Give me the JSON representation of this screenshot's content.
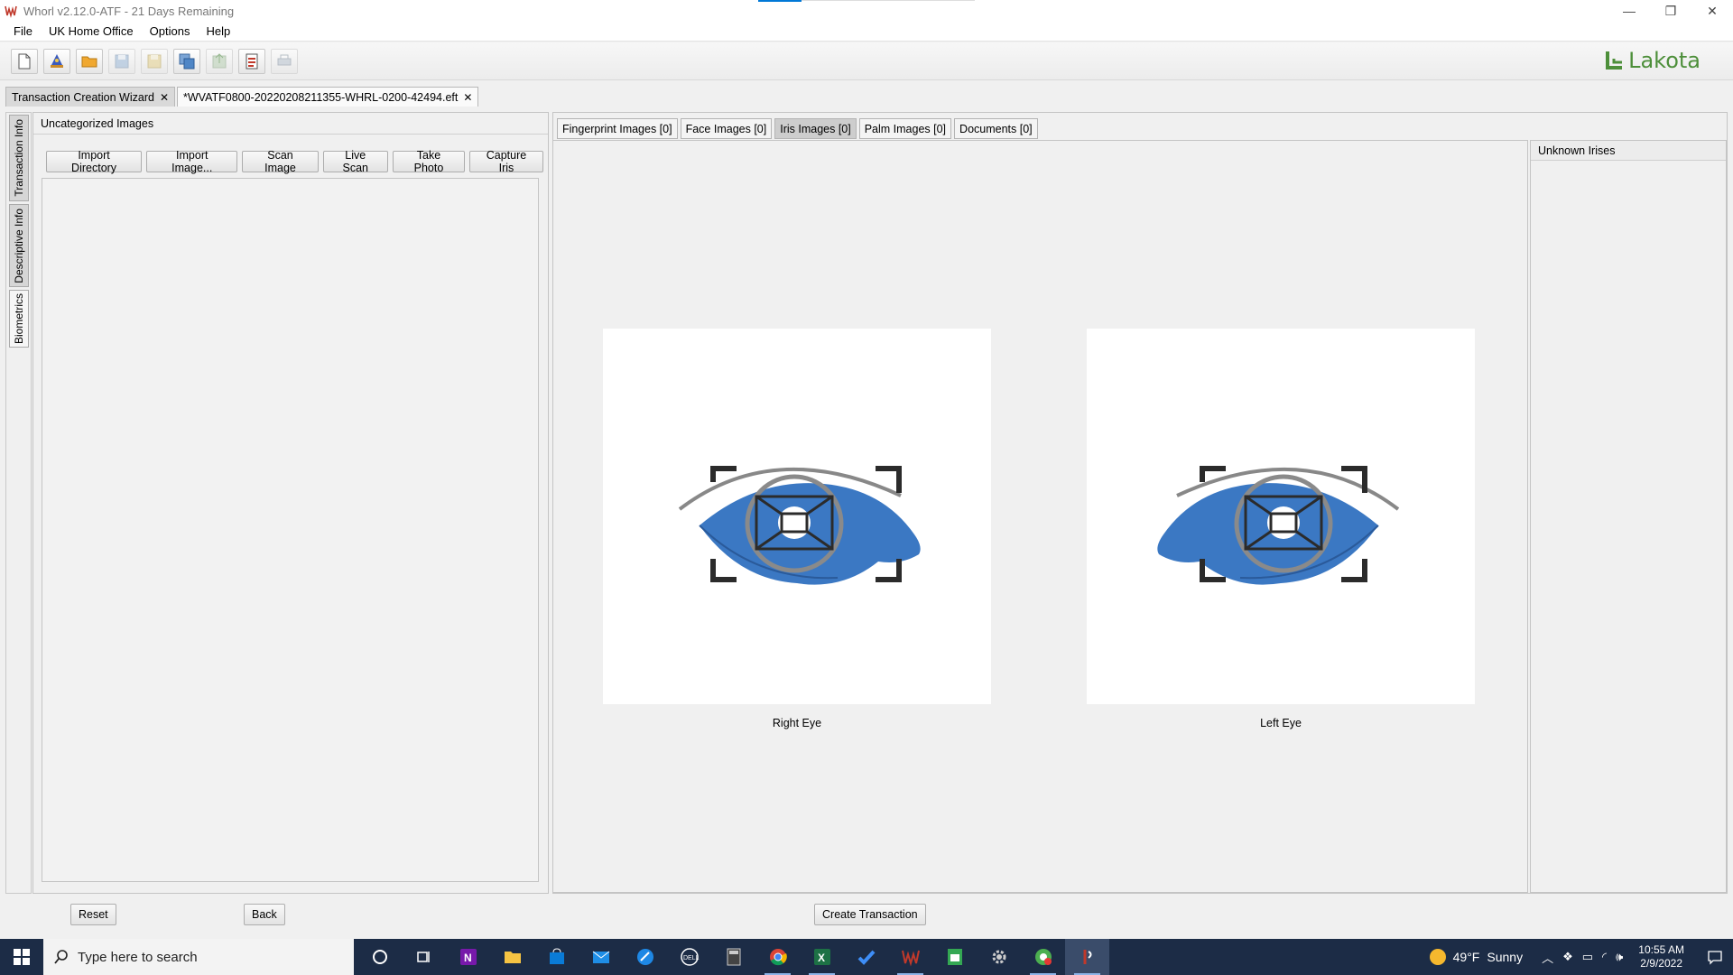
{
  "window": {
    "title": "Whorl v2.12.0-ATF - 21 Days Remaining",
    "controls": {
      "minimize": "—",
      "restore": "❐",
      "close": "✕"
    }
  },
  "menu": [
    "File",
    "UK Home Office",
    "Options",
    "Help"
  ],
  "toolbar": {
    "buttons": [
      {
        "icon": "new-document-icon",
        "enabled": true
      },
      {
        "icon": "wizard-icon",
        "enabled": true
      },
      {
        "icon": "open-folder-icon",
        "enabled": true
      },
      {
        "icon": "save-icon",
        "enabled": false
      },
      {
        "icon": "save-as-icon",
        "enabled": false
      },
      {
        "icon": "save-all-icon",
        "enabled": true
      },
      {
        "icon": "export-icon",
        "enabled": false
      },
      {
        "icon": "report-icon",
        "enabled": true
      },
      {
        "icon": "print-icon",
        "enabled": false
      }
    ],
    "logo_text": "Lakota",
    "logo_color": "#4d8f3a"
  },
  "document_tabs": [
    {
      "label": "Transaction Creation Wizard",
      "active": false
    },
    {
      "label": "*WVATF0800-20220208211355-WHRL-0200-42494.eft",
      "active": true
    }
  ],
  "side_tabs": [
    "Transaction Info",
    "Descriptive Info",
    "Biometrics"
  ],
  "left_panel": {
    "header": "Uncategorized Images",
    "buttons": [
      "Import Directory",
      "Import Image...",
      "Scan Image",
      "Live Scan",
      "Take Photo",
      "Capture Iris"
    ]
  },
  "biometric_tabs": [
    {
      "label": "Fingerprint Images [0]",
      "active": false
    },
    {
      "label": "Face Images [0]",
      "active": false
    },
    {
      "label": "Iris Images [0]",
      "active": true
    },
    {
      "label": "Palm Images [0]",
      "active": false
    },
    {
      "label": "Documents [0]",
      "active": false
    }
  ],
  "iris": {
    "right_label": "Right Eye",
    "left_label": "Left Eye",
    "eye_color": "#3b78c3"
  },
  "unknown_panel": {
    "header": "Unknown Irises"
  },
  "bottom": {
    "reset": "Reset",
    "back": "Back",
    "create": "Create Transaction"
  },
  "taskbar": {
    "search_placeholder": "Type here to search",
    "apps": [
      "cortana-icon",
      "task-view-icon",
      "onenote-icon",
      "file-explorer-icon",
      "store-icon",
      "mail-icon",
      "browser-icon",
      "dell-icon",
      "calculator-icon",
      "chrome-icon",
      "excel-icon",
      "todo-icon",
      "whorl-icon",
      "sheets-icon",
      "settings-icon",
      "chrome-profile-icon",
      "lakota-app-icon"
    ],
    "weather_temp": "49°F",
    "weather_condition": "Sunny",
    "time": "10:55 AM",
    "date": "2/9/2022"
  }
}
